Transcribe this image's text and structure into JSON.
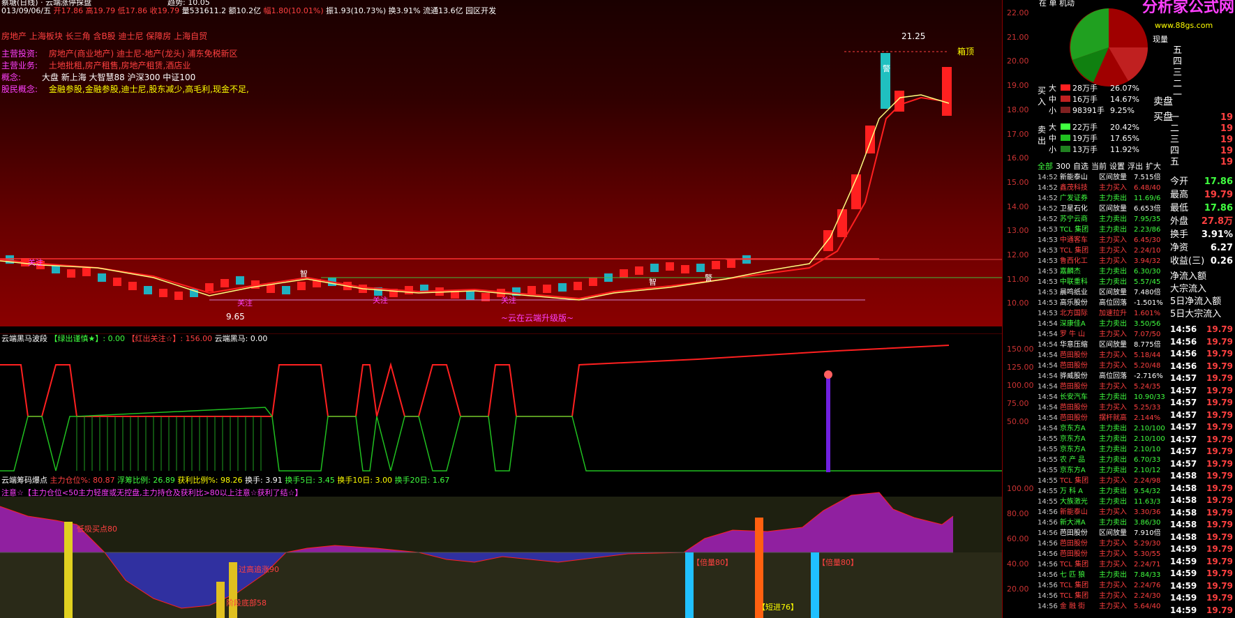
{
  "header": {
    "line1_left": "蔡塘(日线) · 云端涨停探盘",
    "trend_label": "趋势: 10.05",
    "date": "013/09/06/五",
    "open": "开17.86",
    "high": "高19.79",
    "low": "低17.86",
    "close": "收19.79",
    "volume": "量531611.2",
    "amount": "额10.2亿",
    "change": "幅1.80(10.01%)",
    "amplitude": "振1.93(10.73%)",
    "turnover": "换3.91%",
    "float": "流通13.6亿",
    "sector": "园区开发"
  },
  "info_rows": {
    "row0": "房地产 上海板块 长三角 含B股 迪士尼 保障房 上海自贸",
    "row1_label": "主营投资:",
    "row1_value": "房地产(商业地产) 迪士尼-地产(龙头) 浦东免税新区",
    "row2_label": "主营业务:",
    "row2_value": "土地批租,房产租售,房地产租赁,酒店业",
    "row3_label": "概念:",
    "row3_value": "大盘 新上海 大智慧88 沪深300 中证100",
    "row4_label": "股民概念:",
    "row4_value": "金融参股,金融参股,迪士尼,股东减少,高毛利,现金不足,"
  },
  "main_chart": {
    "price_axis": [
      "22.00",
      "21.00",
      "20.00",
      "19.00",
      "18.00",
      "17.00",
      "16.00",
      "15.00",
      "14.00",
      "13.00",
      "12.00",
      "11.00",
      "10.00"
    ],
    "high_label": "21.25",
    "low_label": "9.65",
    "box_top_label": "箱顶",
    "cloud_text": "~云在云端升级版~",
    "annot_guanzhu": "关注",
    "annot_zhi": "智",
    "annot_jing": "警"
  },
  "sub1": {
    "title": "云端黑马波段",
    "green_label": "【绿出谨慎★】: 0.00",
    "red_label": "【红出关注☆】: 156.00",
    "dark_horse": "云端黑马: 0.00",
    "axis": [
      "150.00",
      "125.00",
      "100.00",
      "75.00",
      "50.00"
    ]
  },
  "sub2": {
    "title": "云端筹码爆点",
    "main_pos": "主力仓位%: 80.87",
    "float_ratio": "浮筹比例: 26.89",
    "profit_ratio": "获利比例%: 98.26",
    "turn1": "换手: 3.91",
    "turn5": "换手5日: 3.45",
    "turn10": "换手10日: 3.00",
    "turn20": "换手20日: 1.67",
    "note": "注意☆【主力仓位<50主力轻度或无控盘,主力持仓及获利比>80以上注意☆获利了结☆】",
    "axis": [
      "100.00",
      "80.00",
      "60.00",
      "40.00",
      "20.00"
    ],
    "label_bottom_buy": "低吸买点80",
    "label_pullback": "过高追涨90",
    "label_bottom": "阶段底部58",
    "label_double1": "【倍量80】",
    "label_short": "【短进76】",
    "label_double2": "【倍量80】"
  },
  "right": {
    "logo_text": "分析家公式网",
    "logo_url": "www.88gs.com",
    "sell_levels": [
      "五",
      "四",
      "三",
      "二",
      "一"
    ],
    "sell_label": "卖盘",
    "buy_label": "买盘",
    "buy_levels": [
      {
        "lv": "一",
        "p": "19"
      },
      {
        "lv": "二",
        "p": "19"
      },
      {
        "lv": "三",
        "p": "19"
      },
      {
        "lv": "四",
        "p": "19"
      },
      {
        "lv": "五",
        "p": "19"
      }
    ],
    "top_tabs": "在 单 机动",
    "flow_title": "现量",
    "flow_buy": [
      {
        "k": "大",
        "v": "28万手",
        "p": "26.07%"
      },
      {
        "k": "中",
        "v": "16万手",
        "p": "14.67%"
      },
      {
        "k": "小",
        "v": "98391手",
        "p": "9.25%"
      }
    ],
    "flow_sell": [
      {
        "k": "大",
        "v": "22万手",
        "p": "20.42%"
      },
      {
        "k": "中",
        "v": "19万手",
        "p": "17.65%"
      },
      {
        "k": "小",
        "v": "13万手",
        "p": "11.92%"
      }
    ],
    "buy_side": "买入",
    "sell_side": "卖出",
    "tabs": [
      "全部",
      "300",
      "自选",
      "当前",
      "设置",
      "浮出",
      "扩大"
    ],
    "stats": [
      {
        "k": "今开",
        "v": "17.86"
      },
      {
        "k": "最高",
        "v": "19.79"
      },
      {
        "k": "最低",
        "v": "17.86"
      },
      {
        "k": "外盘",
        "v": "27.8万"
      },
      {
        "k": "换手",
        "v": "3.91%"
      },
      {
        "k": "净资",
        "v": "6.27"
      },
      {
        "k": "收益(三)",
        "v": "0.26"
      }
    ],
    "flows": [
      "净流入额",
      "大宗流入",
      "5日净流入额",
      "5日大宗流入"
    ],
    "radar": [
      {
        "t": "14:52",
        "n": "新能泰山",
        "a": "区间放量",
        "v": "7.515倍",
        "c": "white"
      },
      {
        "t": "14:52",
        "n": "鑫茂科技",
        "a": "主力买入",
        "v": "6.48/40",
        "c": "red"
      },
      {
        "t": "14:52",
        "n": "广发证券",
        "a": "主力卖出",
        "v": "11.69/6",
        "c": "green"
      },
      {
        "t": "14:52",
        "n": "卫星石化",
        "a": "区间放量",
        "v": "6.653倍",
        "c": "white"
      },
      {
        "t": "14:52",
        "n": "苏宁云商",
        "a": "主力卖出",
        "v": "7.95/35",
        "c": "green"
      },
      {
        "t": "14:53",
        "n": "TCL 集团",
        "a": "主力卖出",
        "v": "2.23/86",
        "c": "green"
      },
      {
        "t": "14:53",
        "n": "中通客车",
        "a": "主力买入",
        "v": "6.45/30",
        "c": "red"
      },
      {
        "t": "14:53",
        "n": "TCL 集团",
        "a": "主力买入",
        "v": "2.24/10",
        "c": "red"
      },
      {
        "t": "14:53",
        "n": "鲁西化工",
        "a": "主力买入",
        "v": "3.94/32",
        "c": "red"
      },
      {
        "t": "14:53",
        "n": "嘉麟杰",
        "a": "主力卖出",
        "v": "6.30/30",
        "c": "green"
      },
      {
        "t": "14:53",
        "n": "中联重科",
        "a": "主力卖出",
        "v": "5.57/45",
        "c": "green"
      },
      {
        "t": "14:53",
        "n": "晨鸣纸业",
        "a": "区间放量",
        "v": "7.480倍",
        "c": "white"
      },
      {
        "t": "14:53",
        "n": "高乐股份",
        "a": "高位回落",
        "v": "-1.501%",
        "c": "white"
      },
      {
        "t": "14:53",
        "n": "北方国际",
        "a": "加速拉升",
        "v": "1.601%",
        "c": "red"
      },
      {
        "t": "14:54",
        "n": "深康佳A",
        "a": "主力卖出",
        "v": "3.50/56",
        "c": "green"
      },
      {
        "t": "14:54",
        "n": "罗 牛 山",
        "a": "主力买入",
        "v": "7.07/50",
        "c": "red"
      },
      {
        "t": "14:54",
        "n": "华意压缩",
        "a": "区间放量",
        "v": "8.775倍",
        "c": "white"
      },
      {
        "t": "14:54",
        "n": "芭田股份",
        "a": "主力买入",
        "v": "5.18/44",
        "c": "red"
      },
      {
        "t": "14:54",
        "n": "芭田股份",
        "a": "主力买入",
        "v": "5.20/48",
        "c": "red"
      },
      {
        "t": "14:54",
        "n": "骅威股份",
        "a": "高位回落",
        "v": "-2.716%",
        "c": "white"
      },
      {
        "t": "14:54",
        "n": "芭田股份",
        "a": "主力买入",
        "v": "5.24/35",
        "c": "red"
      },
      {
        "t": "14:54",
        "n": "长安汽车",
        "a": "主力卖出",
        "v": "10.90/33",
        "c": "green"
      },
      {
        "t": "14:54",
        "n": "芭田股份",
        "a": "主力买入",
        "v": "5.25/33",
        "c": "red"
      },
      {
        "t": "14:54",
        "n": "芭田股份",
        "a": "摆杆就高",
        "v": "2.144%",
        "c": "red"
      },
      {
        "t": "14:54",
        "n": "京东方A",
        "a": "主力卖出",
        "v": "2.10/100",
        "c": "green"
      },
      {
        "t": "14:55",
        "n": "京东方A",
        "a": "主力卖出",
        "v": "2.10/100",
        "c": "green"
      },
      {
        "t": "14:55",
        "n": "京东方A",
        "a": "主力卖出",
        "v": "2.10/10",
        "c": "green"
      },
      {
        "t": "14:55",
        "n": "农 产 品",
        "a": "主力卖出",
        "v": "6.70/33",
        "c": "green"
      },
      {
        "t": "14:55",
        "n": "京东方A",
        "a": "主力卖出",
        "v": "2.10/12",
        "c": "green"
      },
      {
        "t": "14:55",
        "n": "TCL 集团",
        "a": "主力买入",
        "v": "2.24/98",
        "c": "red"
      },
      {
        "t": "14:55",
        "n": "万 科 A",
        "a": "主力卖出",
        "v": "9.54/32",
        "c": "green"
      },
      {
        "t": "14:55",
        "n": "大族激光",
        "a": "主力卖出",
        "v": "11.63/3",
        "c": "green"
      },
      {
        "t": "14:56",
        "n": "新能泰山",
        "a": "主力买入",
        "v": "3.30/36",
        "c": "red"
      },
      {
        "t": "14:56",
        "n": "新大洲A",
        "a": "主力卖出",
        "v": "3.86/30",
        "c": "green"
      },
      {
        "t": "14:56",
        "n": "芭田股份",
        "a": "区间放量",
        "v": "7.910倍",
        "c": "white"
      },
      {
        "t": "14:56",
        "n": "芭田股份",
        "a": "主力买入",
        "v": "5.29/30",
        "c": "red"
      },
      {
        "t": "14:56",
        "n": "芭田股份",
        "a": "主力买入",
        "v": "5.30/55",
        "c": "red"
      },
      {
        "t": "14:56",
        "n": "TCL 集团",
        "a": "主力买入",
        "v": "2.24/71",
        "c": "red"
      },
      {
        "t": "14:56",
        "n": "七 匹 狼",
        "a": "主力卖出",
        "v": "7.84/33",
        "c": "green"
      },
      {
        "t": "14:56",
        "n": "TCL 集团",
        "a": "主力买入",
        "v": "2.24/76",
        "c": "red"
      },
      {
        "t": "14:56",
        "n": "TCL 集团",
        "a": "主力买入",
        "v": "2.24/30",
        "c": "red"
      },
      {
        "t": "14:56",
        "n": "金 融 街",
        "a": "主力买入",
        "v": "5.64/40",
        "c": "red"
      }
    ],
    "ticks": [
      {
        "t": "14:56",
        "p": "19.79"
      },
      {
        "t": "14:56",
        "p": "19.79"
      },
      {
        "t": "14:56",
        "p": "19.79"
      },
      {
        "t": "14:56",
        "p": "19.79"
      },
      {
        "t": "14:57",
        "p": "19.79"
      },
      {
        "t": "14:57",
        "p": "19.79"
      },
      {
        "t": "14:57",
        "p": "19.79"
      },
      {
        "t": "14:57",
        "p": "19.79"
      },
      {
        "t": "14:57",
        "p": "19.79"
      },
      {
        "t": "14:57",
        "p": "19.79"
      },
      {
        "t": "14:57",
        "p": "19.79"
      },
      {
        "t": "14:57",
        "p": "19.79"
      },
      {
        "t": "14:58",
        "p": "19.79"
      },
      {
        "t": "14:58",
        "p": "19.79"
      },
      {
        "t": "14:58",
        "p": "19.79"
      },
      {
        "t": "14:58",
        "p": "19.79"
      },
      {
        "t": "14:58",
        "p": "19.79"
      },
      {
        "t": "14:58",
        "p": "19.79"
      },
      {
        "t": "14:59",
        "p": "19.79"
      },
      {
        "t": "14:59",
        "p": "19.79"
      },
      {
        "t": "14:59",
        "p": "19.79"
      },
      {
        "t": "14:59",
        "p": "19.79"
      },
      {
        "t": "14:59",
        "p": "19.79"
      },
      {
        "t": "14:59",
        "p": "19.79"
      }
    ]
  }
}
